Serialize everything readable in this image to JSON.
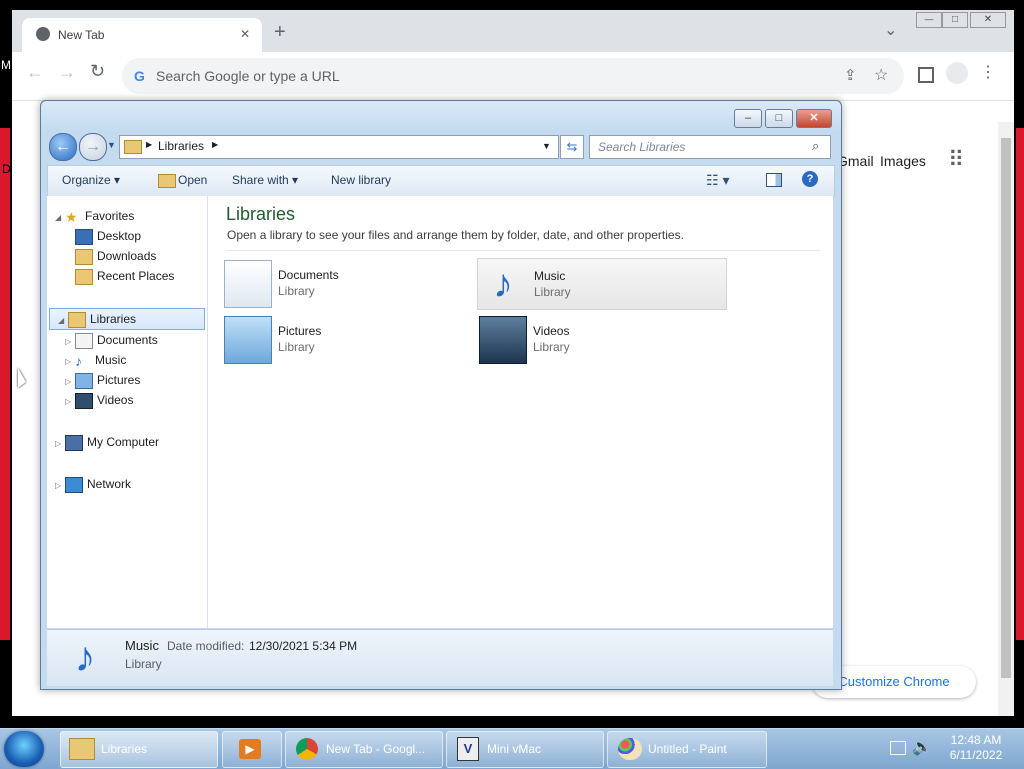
{
  "chrome": {
    "tab_title": "New Tab",
    "tab_close": "✕",
    "new_tab": "+",
    "window_controls": {
      "minimize": "—",
      "maximize": "□",
      "close": "✕"
    },
    "tab_search": "⌄",
    "omnibox_placeholder": "Search Google or type a URL",
    "links": {
      "gmail": "Gmail",
      "images": "Images"
    },
    "customize": "Customize Chrome",
    "desktop_fragment_m": "M",
    "desktop_fragment_d": "D"
  },
  "explorer": {
    "breadcrumb": [
      "Libraries"
    ],
    "search_placeholder": "Search Libraries",
    "toolbar": {
      "organize": "Organize",
      "open": "Open",
      "share_with": "Share with",
      "new_library": "New library"
    },
    "nav": {
      "favorites": "Favorites",
      "favorites_items": [
        "Desktop",
        "Downloads",
        "Recent Places"
      ],
      "libraries": "Libraries",
      "libraries_items": [
        "Documents",
        "Music",
        "Pictures",
        "Videos"
      ],
      "computer": "My Computer",
      "network": "Network"
    },
    "main": {
      "heading": "Libraries",
      "description": "Open a library to see your files and arrange them by folder, date, and other properties.",
      "items": [
        {
          "name": "Documents",
          "type": "Library"
        },
        {
          "name": "Music",
          "type": "Library"
        },
        {
          "name": "Pictures",
          "type": "Library"
        },
        {
          "name": "Videos",
          "type": "Library"
        }
      ]
    },
    "details": {
      "name": "Music",
      "modified_label": "Date modified:",
      "modified_value": "12/30/2021 5:34 PM",
      "type": "Library"
    }
  },
  "taskbar": {
    "items": [
      "Libraries",
      "",
      "New Tab - Googl...",
      "Mini vMac",
      "Untitled - Paint"
    ],
    "time": "12:48 AM",
    "date": "6/11/2022"
  }
}
